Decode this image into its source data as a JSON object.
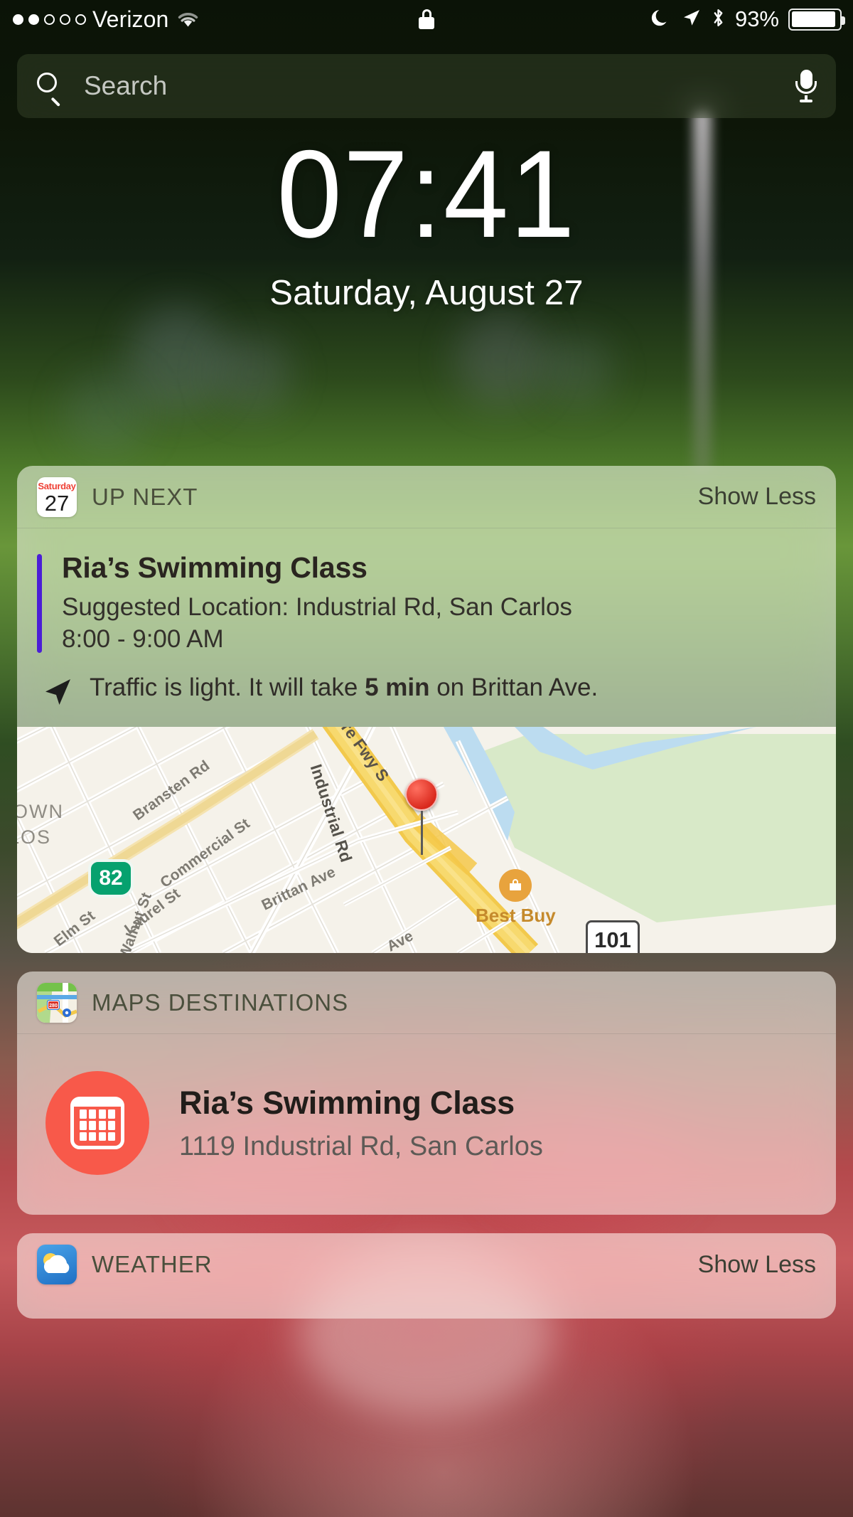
{
  "status_bar": {
    "signal_dots_filled": 2,
    "signal_dots_total": 5,
    "carrier": "Verizon",
    "wifi_icon": "wifi-icon",
    "lock_icon": "lock-icon",
    "dnd_icon": "moon-icon",
    "location_icon": "location-arrow-icon",
    "bluetooth_icon": "bluetooth-icon",
    "battery_percent": "93%",
    "battery_level": 93
  },
  "search": {
    "placeholder": "Search",
    "value": "",
    "search_icon": "search-icon",
    "mic_icon": "microphone-icon"
  },
  "clock": {
    "time": "07:41",
    "date": "Saturday, August 27"
  },
  "widgets": [
    {
      "id": "up-next",
      "header": "UP NEXT",
      "action": "Show Less",
      "icon": "calendar-icon",
      "calendar_icon": {
        "weekday": "Saturday",
        "day": "27"
      },
      "event": {
        "title": "Ria’s Swimming Class",
        "location": "Suggested Location: Industrial Rd, San Carlos",
        "time": "8:00 - 9:00 AM",
        "accent_color": "#4b1ed6"
      },
      "traffic": {
        "icon": "navigation-arrow-icon",
        "prefix": "Traffic is light. It will take ",
        "duration": "5 min",
        "suffix": " on Brittan Ave."
      },
      "map": {
        "city_lines": [
          "OWN",
          "LOS"
        ],
        "street_labels": [
          "Bransten Rd",
          "Commercial St",
          "Industrial Rd",
          "Brittan Ave",
          "Laurel St",
          "Walnut St",
          "Elm St",
          "ore Fwy S"
        ],
        "route_shields": [
          "82",
          "101"
        ],
        "poi": "Best Buy",
        "pin": "map-pin-destination"
      }
    },
    {
      "id": "maps-destinations",
      "header": "MAPS DESTINATIONS",
      "icon": "maps-icon",
      "maps_icon_shield": "280",
      "destination": {
        "title": "Ria’s Swimming Class",
        "address": "1119 Industrial Rd, San Carlos",
        "icon": "calendar-destination-icon",
        "icon_color": "#f8594a"
      }
    },
    {
      "id": "weather",
      "header": "WEATHER",
      "action": "Show Less",
      "icon": "weather-icon"
    }
  ],
  "colors": {
    "accent_event": "#4b1ed6",
    "destination_circle": "#f8594a",
    "calendar_red": "#ef4136",
    "highway_green": "#06a16e"
  }
}
